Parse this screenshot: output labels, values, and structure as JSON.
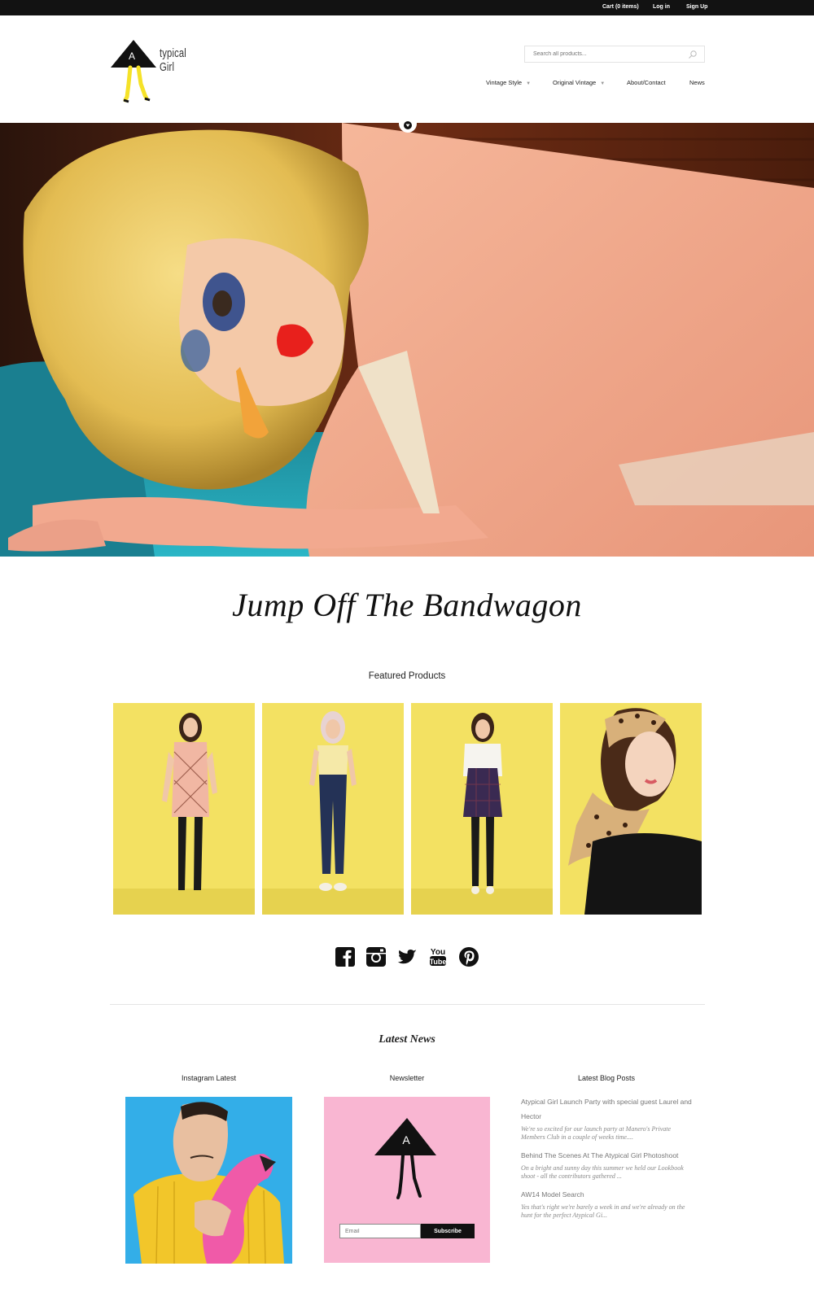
{
  "topbar": {
    "cart": "Cart (0 items)",
    "login": "Log in",
    "signup": "Sign Up"
  },
  "header": {
    "logo_letter": "A",
    "logo_text": "typical Girl",
    "search_placeholder": "Search all products...",
    "nav": [
      {
        "label": "Vintage Style",
        "dropdown": true
      },
      {
        "label": "Original Vintage",
        "dropdown": true
      },
      {
        "label": "About/Contact",
        "dropdown": false
      },
      {
        "label": "News",
        "dropdown": false
      }
    ]
  },
  "hero": {
    "toggle_icon": "chevron-down-icon"
  },
  "headline": "Jump Off The Bandwagon",
  "featured": {
    "title": "Featured Products",
    "products": [
      {
        "name": "diamond-print-dress-product"
      },
      {
        "name": "high-waist-jeans-product"
      },
      {
        "name": "plaid-pinafore-product"
      },
      {
        "name": "leopard-headscarf-product"
      }
    ]
  },
  "social": [
    "facebook-icon",
    "instagram-icon",
    "twitter-icon",
    "youtube-icon",
    "pinterest-icon"
  ],
  "latest_news": {
    "title": "Latest News",
    "instagram_title": "Instagram Latest",
    "newsletter_title": "Newsletter",
    "newsletter_logo_letter": "A",
    "email_placeholder": "Email",
    "subscribe_label": "Subscribe",
    "blog_title": "Latest Blog Posts",
    "posts": [
      {
        "title": "Atypical Girl Launch Party with special guest Laurel and Hector",
        "excerpt": "We're so excited for our launch party at Manero's Private Members Club in a couple of weeks time...."
      },
      {
        "title": "Behind The Scenes At The Atypical Girl Photoshoot",
        "excerpt": "On a bright and sunny day this summer we held our Lookbook shoot - all the contributors gathered ..."
      },
      {
        "title": "AW14 Model Search",
        "excerpt": "Yes that's right we're barely a week in and we're already on the hunt for the perfect Atypical Gi..."
      }
    ]
  },
  "colors": {
    "topbar": "#121212",
    "product_bg": "#f4e05e",
    "newsletter_bg": "#f9b6d2",
    "logo_legs": "#f5e228",
    "insta_bg": "#33aee8"
  }
}
